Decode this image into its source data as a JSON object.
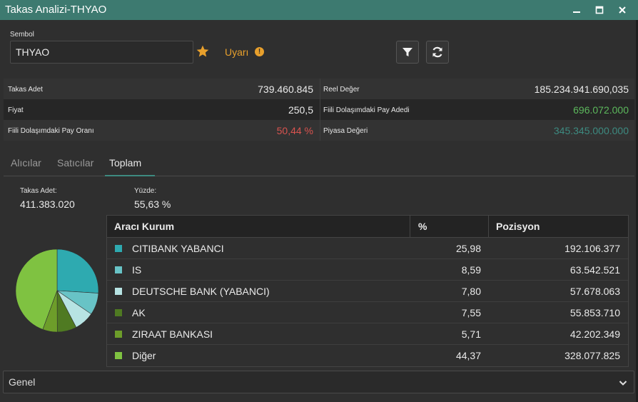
{
  "window": {
    "title": "Takas Analizi-THYAO"
  },
  "symbol": {
    "label": "Sembol",
    "value": "THYAO",
    "alert_label": "Uyarı",
    "alert_icon": "!"
  },
  "stats": {
    "takas_adet_label": "Takas Adet",
    "takas_adet_value": "739.460.845",
    "reel_deger_label": "Reel Değer",
    "reel_deger_value": "185.234.941.690,035",
    "fiyat_label": "Fiyat",
    "fiyat_value": "250,5",
    "fiili_adet_label": "Fiili Dolaşımdaki Pay Adedi",
    "fiili_adet_value": "696.072.000",
    "fiili_oran_label": "Fiili Dolaşımdaki Pay Oranı",
    "fiili_oran_value": "50,44 %",
    "piyasa_label": "Piyasa Değeri",
    "piyasa_value": "345.345.000.000"
  },
  "colors": {
    "accent": "#3d7a70",
    "green_value": "#5cb85c",
    "red_value": "#d9534f",
    "teal_value": "#3d8a80",
    "alert": "#e8a02c"
  },
  "tabs": [
    {
      "label": "Alıcılar"
    },
    {
      "label": "Satıcılar"
    },
    {
      "label": "Toplam"
    }
  ],
  "active_tab": "Toplam",
  "summary": {
    "takas_label": "Takas Adet:",
    "takas_value": "411.383.020",
    "yuzde_label": "Yüzde:",
    "yuzde_value": "55,63 %"
  },
  "table": {
    "headers": [
      "Aracı Kurum",
      "%",
      "Pozisyon"
    ],
    "rows": [
      {
        "name": "CITIBANK YABANCI",
        "pct": "25,98",
        "pos": "192.106.377",
        "pct_num": 25.98,
        "color": "#2eaab0"
      },
      {
        "name": "IS",
        "pct": "8,59",
        "pos": "63.542.521",
        "pct_num": 8.59,
        "color": "#68c3c6"
      },
      {
        "name": "DEUTSCHE BANK (YABANCI)",
        "pct": "7,80",
        "pos": "57.678.063",
        "pct_num": 7.8,
        "color": "#b7e3e3"
      },
      {
        "name": "AK",
        "pct": "7,55",
        "pos": "55.853.710",
        "pct_num": 7.55,
        "color": "#4f7a22"
      },
      {
        "name": "ZIRAAT BANKASI",
        "pct": "5,71",
        "pos": "42.202.349",
        "pct_num": 5.71,
        "color": "#6d9d2a"
      },
      {
        "name": "Diğer",
        "pct": "44,37",
        "pos": "328.077.825",
        "pct_num": 44.37,
        "color": "#7fc241"
      }
    ]
  },
  "footer": {
    "dropdown_value": "Genel"
  },
  "icons": {
    "minimize": "minimize-icon",
    "maximize": "maximize-icon",
    "close": "close-icon",
    "favorite": "star-icon",
    "filter": "filter-icon",
    "refresh": "refresh-icon",
    "dropdown": "chevron-down-icon"
  }
}
